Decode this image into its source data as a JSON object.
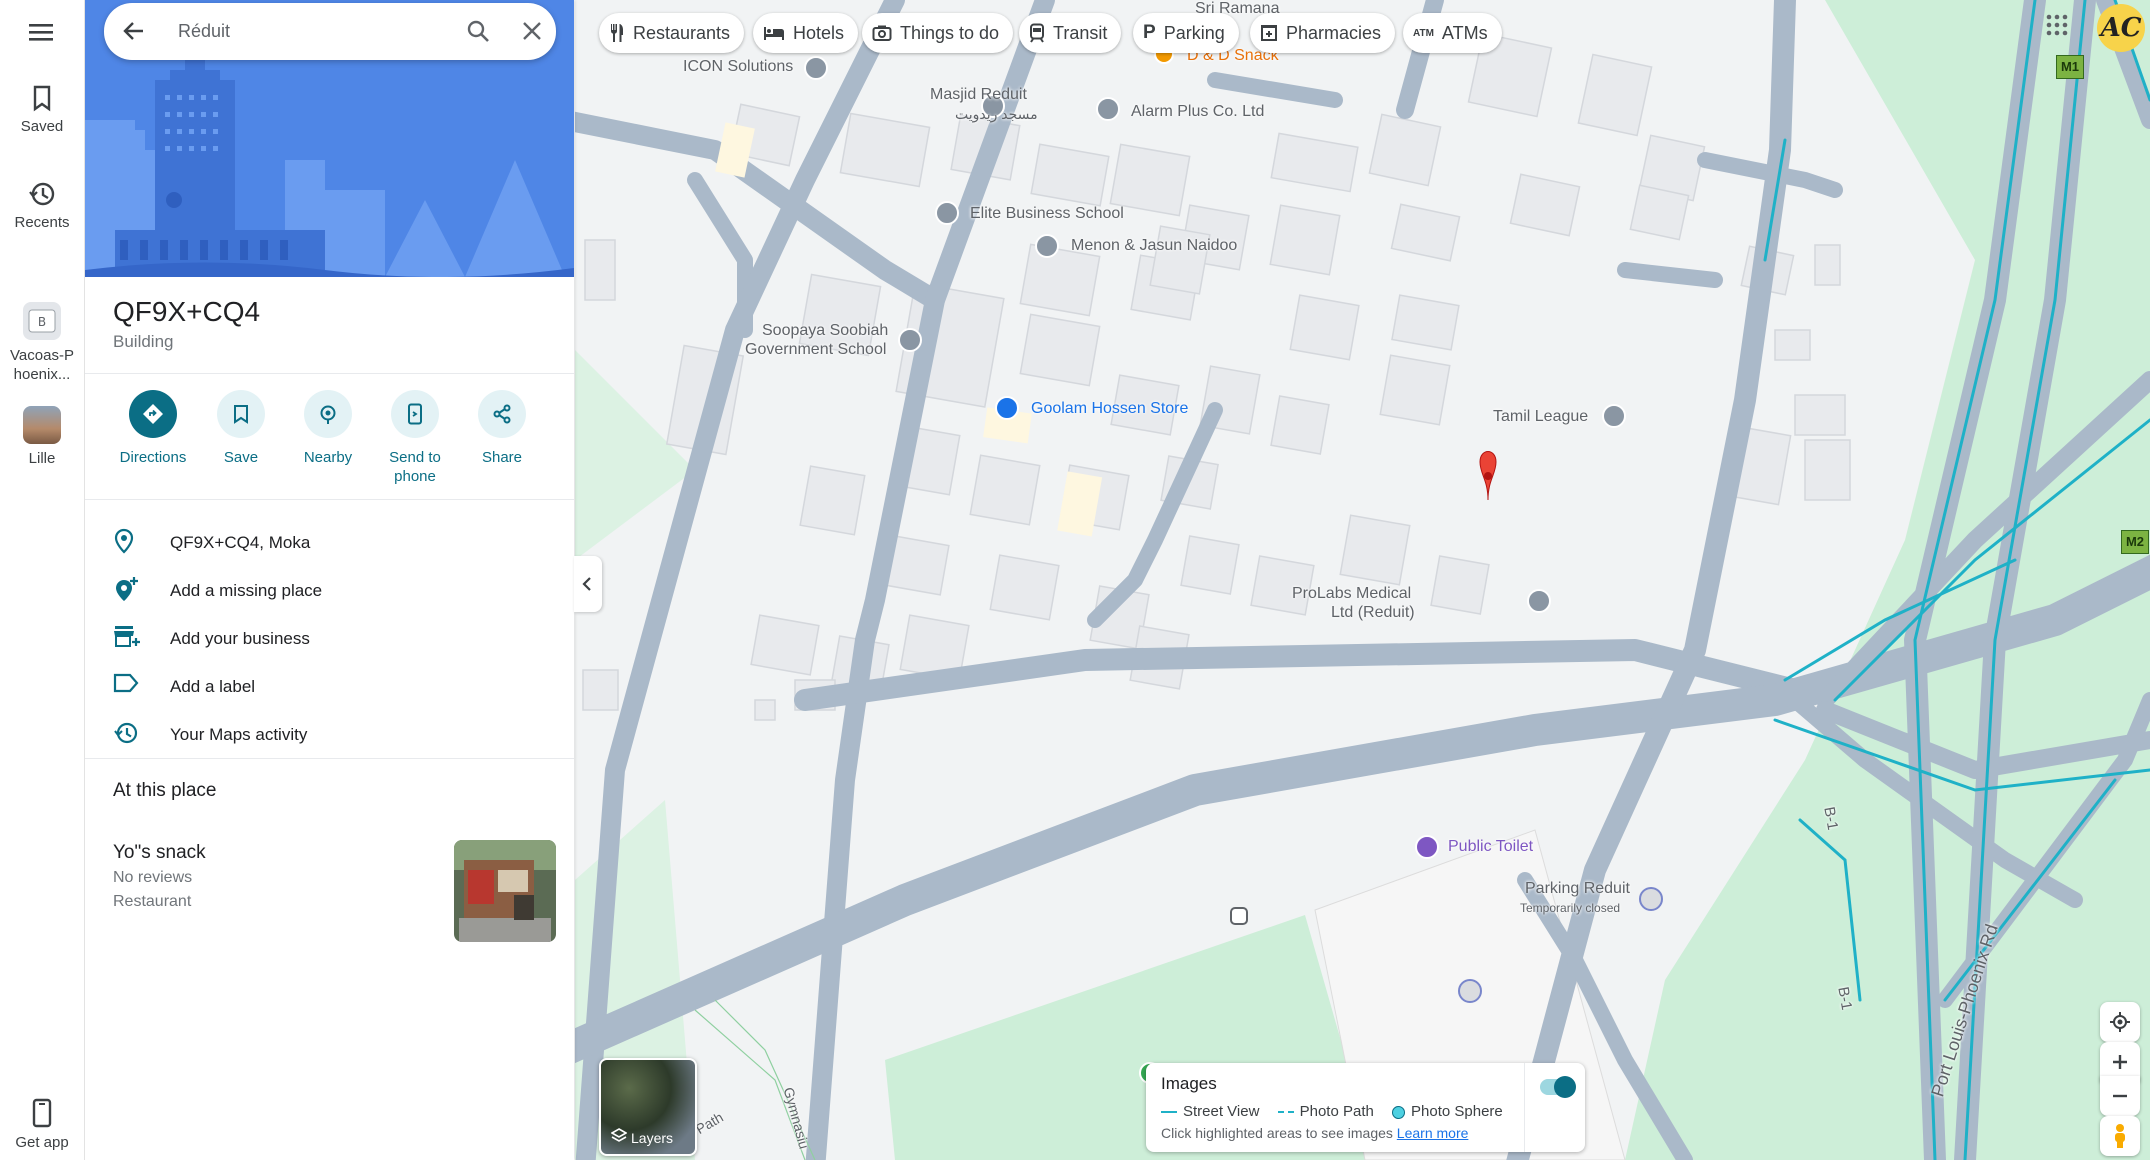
{
  "rail": {
    "saved": "Saved",
    "recents": "Recents",
    "recent1": "Vacoas-Phoenix...",
    "recent2": "Lille",
    "get_app": "Get app"
  },
  "search": {
    "query": "Réduit"
  },
  "place": {
    "title": "QF9X+CQ4",
    "subtitle": "Building"
  },
  "actions": [
    {
      "label": "Directions"
    },
    {
      "label": "Save"
    },
    {
      "label": "Nearby"
    },
    {
      "label": "Send to phone"
    },
    {
      "label": "Share"
    }
  ],
  "info": [
    {
      "text": "QF9X+CQ4, Moka",
      "icon": "location-pin-icon"
    },
    {
      "text": "Add a missing place",
      "icon": "add-location-icon"
    },
    {
      "text": "Add your business",
      "icon": "add-business-icon"
    },
    {
      "text": "Add a label",
      "icon": "label-icon"
    },
    {
      "text": "Your Maps activity",
      "icon": "history-icon"
    }
  ],
  "at_place": {
    "title": "At this place",
    "business": {
      "name": "Yo\"s snack",
      "reviews": "No reviews",
      "type": "Restaurant"
    }
  },
  "chips": [
    {
      "label": "Restaurants",
      "icon": "fork-knife-icon"
    },
    {
      "label": "Hotels",
      "icon": "bed-icon"
    },
    {
      "label": "Things to do",
      "icon": "camera-icon"
    },
    {
      "label": "Transit",
      "icon": "train-icon"
    },
    {
      "label": "Parking",
      "icon": "parking-icon"
    },
    {
      "label": "Pharmacies",
      "icon": "pharmacy-icon"
    },
    {
      "label": "ATMs",
      "icon": "atm-icon"
    }
  ],
  "map_labels": {
    "icon_solutions": "ICON Solutions",
    "masjid": "Masjid Reduit",
    "masjid_ar": "مسجد ريدويت",
    "sri_ramana": "Sri Ramana",
    "dd_snack": "D & D Snack",
    "alarm_plus": "Alarm Plus Co. Ltd",
    "elite": "Elite Business School",
    "menon": "Menon & Jasun Naidoo",
    "soopaya1": "Soopaya Soobiah",
    "soopaya2": "Government School",
    "goolam": "Goolam Hossen Store",
    "tamil": "Tamil League",
    "prolabs1": "ProLabs Medical",
    "prolabs2": "Ltd (Reduit)",
    "toilet": "Public Toilet",
    "parking": "Parking Reduit",
    "parking_status": "Temporarily closed",
    "b1_a": "B-1",
    "b1_b": "B-1",
    "port_louis": "Port Louis-Phoenix Rd",
    "path": "Path",
    "gymnasium": "Gymnasiu",
    "m1": "M1",
    "m2": "M2"
  },
  "layers": {
    "label": "Layers"
  },
  "images_card": {
    "title": "Images",
    "street_view": "Street View",
    "photo_path": "Photo Path",
    "photo_sphere": "Photo Sphere",
    "hint": "Click highlighted areas to see images",
    "learn_more": "Learn more",
    "toggle_on": true
  },
  "account": {
    "initials": "AC"
  },
  "colors": {
    "accent": "#0b6e85",
    "hero_blue": "#4f86e6",
    "pin_red": "#ea4335",
    "road": "#aab9c9",
    "park": "#cdeed8",
    "street_view_line": "#1fb1c7"
  }
}
